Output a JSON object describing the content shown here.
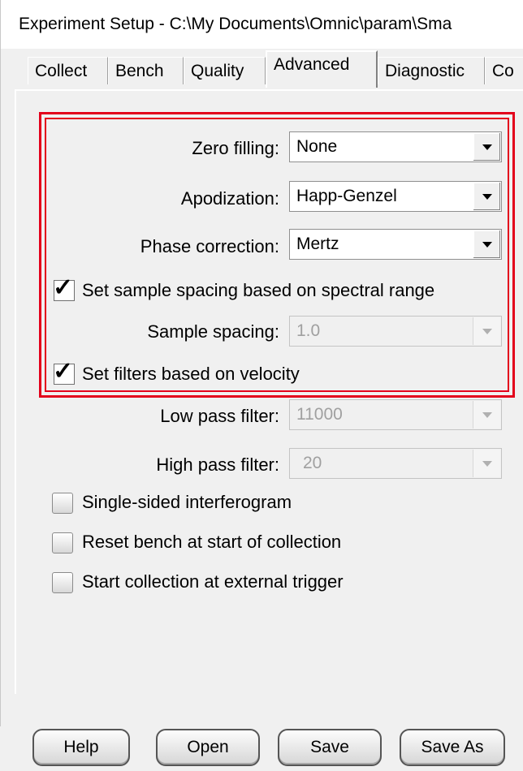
{
  "window": {
    "title": "Experiment Setup - C:\\My Documents\\Omnic\\param\\Sma"
  },
  "tabs": [
    {
      "label": "Collect",
      "active": false
    },
    {
      "label": "Bench",
      "active": false
    },
    {
      "label": "Quality",
      "active": false
    },
    {
      "label": "Advanced",
      "active": true
    },
    {
      "label": "Diagnostic",
      "active": false
    },
    {
      "label": "Co",
      "active": false
    }
  ],
  "advanced": {
    "zero_filling": {
      "label": "Zero filling:",
      "value": "None"
    },
    "apodization": {
      "label": "Apodization:",
      "value": "Happ-Genzel"
    },
    "phase_correction": {
      "label": "Phase correction:",
      "value": "Mertz"
    },
    "set_sample_spacing": {
      "label": "Set sample spacing based on spectral range",
      "checked": true
    },
    "sample_spacing": {
      "label": "Sample spacing:",
      "value": "1.0",
      "enabled": false
    },
    "set_filters": {
      "label": "Set filters based on velocity",
      "checked": true
    },
    "low_pass_filter": {
      "label": "Low pass filter:",
      "value": "11000",
      "enabled": false
    },
    "high_pass_filter": {
      "label": "High pass filter:",
      "value": "20",
      "enabled": false
    },
    "single_sided": {
      "label": "Single-sided interferogram",
      "checked": false
    },
    "reset_bench": {
      "label": "Reset bench at start of collection",
      "checked": false
    },
    "external_trigger": {
      "label": "Start collection at external trigger",
      "checked": false
    }
  },
  "highlight_color": "#e3001b",
  "buttons": {
    "help": "Help",
    "open": "Open",
    "save": "Save",
    "save_as": "Save As"
  }
}
